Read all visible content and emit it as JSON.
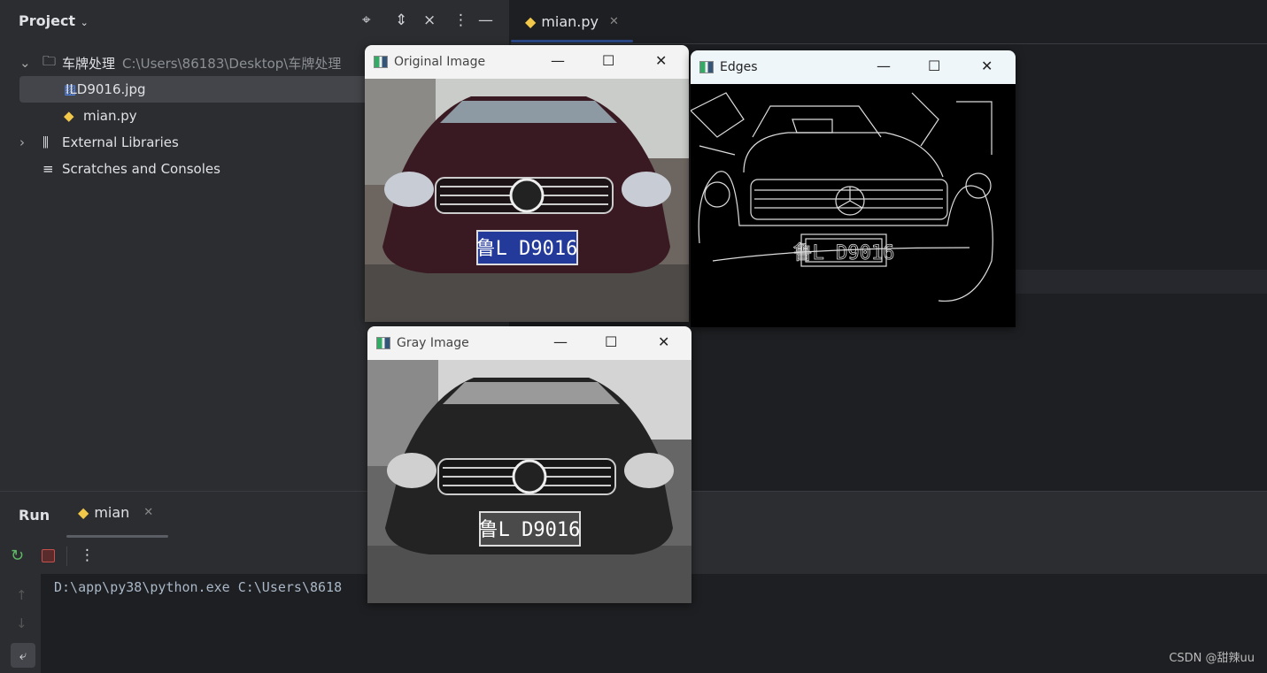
{
  "project_panel": {
    "title": "Project",
    "tree": [
      {
        "label": "车牌处理",
        "path": "C:\\Users\\86183\\Desktop\\车牌处理",
        "icon": "folder-icon"
      },
      {
        "label": "ILD9016.jpg",
        "icon": "image-file-icon",
        "selected": true
      },
      {
        "label": "mian.py",
        "icon": "python-icon"
      },
      {
        "label": "External Libraries",
        "icon": "library-icon"
      },
      {
        "label": "Scratches and Consoles",
        "icon": "scratches-icon"
      }
    ]
  },
  "editor": {
    "tab": "mian.py"
  },
  "run_panel": {
    "title": "Run",
    "tab": "mian",
    "console_line": "D:\\app\\py38\\python.exe C:\\Users\\8618"
  },
  "windows": {
    "original": {
      "title": "Original Image",
      "plate": "鲁L D9016"
    },
    "edges": {
      "title": "Edges",
      "plate": "鲁L D9016"
    },
    "gray": {
      "title": "Gray Image",
      "plate": "鲁L D9016"
    }
  },
  "watermark": "CSDN @甜辣uu",
  "colors": {
    "accent": "#3574f0",
    "stop": "#c94f4f"
  }
}
